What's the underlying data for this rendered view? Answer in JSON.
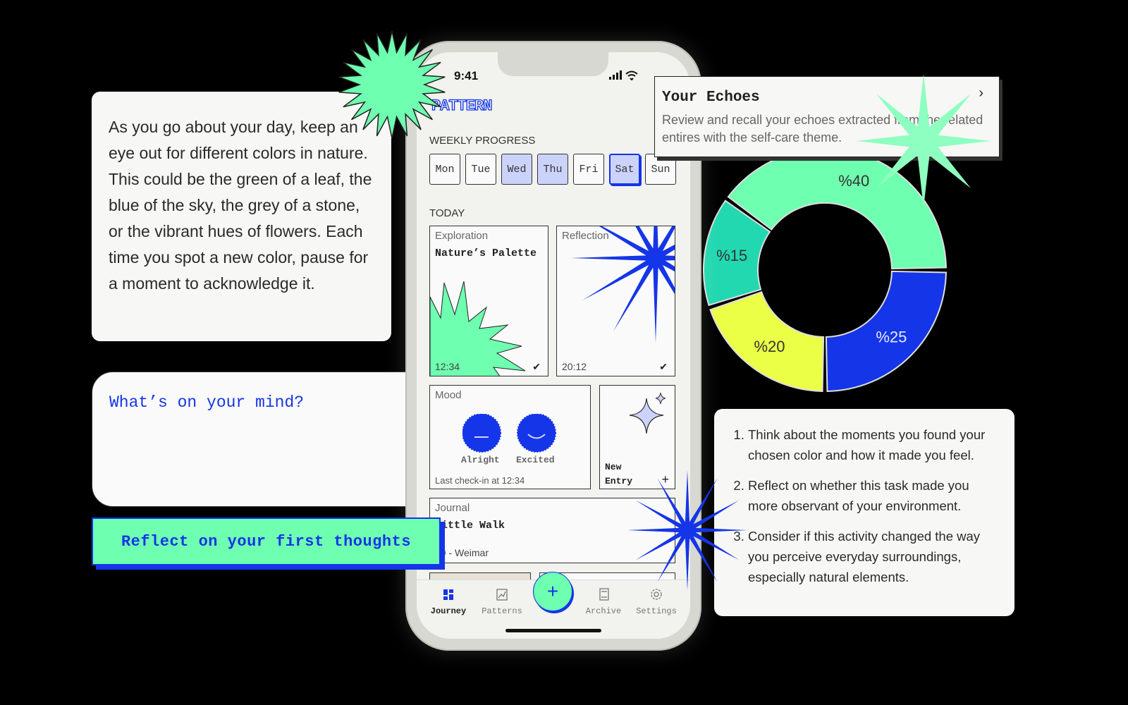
{
  "intro_text": "As you go about your day, keep an eye out for different colors in nature. This could be the green of a leaf, the blue of the sky, the grey of a stone, or the vibrant hues of flowers. Each time you spot a new color, pause for a moment to acknowledge it.",
  "prompt": {
    "placeholder": "What’s on your mind?"
  },
  "reflect_button": "Reflect on your first thoughts",
  "steps": [
    "Think about the moments you found your chosen color and how it made you feel.",
    "Reflect on whether this task made you more observant of your environment.",
    "Consider if this activity changed the way you perceive everyday surroundings, especially natural elements."
  ],
  "echoes": {
    "title": "Your Echoes",
    "description": "Review and recall your echoes extracted from the related entires with the self-care theme.",
    "icon": "chevron-right-icon"
  },
  "phone": {
    "time": "9:41",
    "logo": "PATTERN",
    "weekly_label": "WEEKLY PROGRESS",
    "days": [
      {
        "label": "Mon",
        "state": "none"
      },
      {
        "label": "Tue",
        "state": "none"
      },
      {
        "label": "Wed",
        "state": "done"
      },
      {
        "label": "Thu",
        "state": "done"
      },
      {
        "label": "Fri",
        "state": "none"
      },
      {
        "label": "Sat",
        "state": "selected"
      },
      {
        "label": "Sun",
        "state": "none"
      }
    ],
    "today_label": "TODAY",
    "exploration": {
      "type": "Exploration",
      "title": "Nature’s Palette",
      "time": "12:34"
    },
    "reflection": {
      "type": "Reflection",
      "time": "20:12"
    },
    "mood": {
      "label": "Mood",
      "moods": [
        "Alright",
        "Excited"
      ],
      "last_checkin": "Last check-in at 12:34"
    },
    "new_entry": "New Entry",
    "journal": {
      "label": "Journal",
      "title": "Little Walk",
      "meta": "09 - Weimar"
    },
    "nav": [
      "Journey",
      "Patterns",
      "Archive",
      "Settings"
    ]
  },
  "colors": {
    "blue": "#1435e8",
    "green": "#6effb0",
    "teal": "#22d8b0",
    "yellow": "#eaff45"
  },
  "chart_data": {
    "type": "pie",
    "style": "donut",
    "categories": [
      "%40",
      "%25",
      "%20",
      "%15"
    ],
    "values": [
      40,
      25,
      20,
      15
    ],
    "colors": [
      "#6effb0",
      "#1435e8",
      "#eaff45",
      "#22d8b0"
    ]
  }
}
